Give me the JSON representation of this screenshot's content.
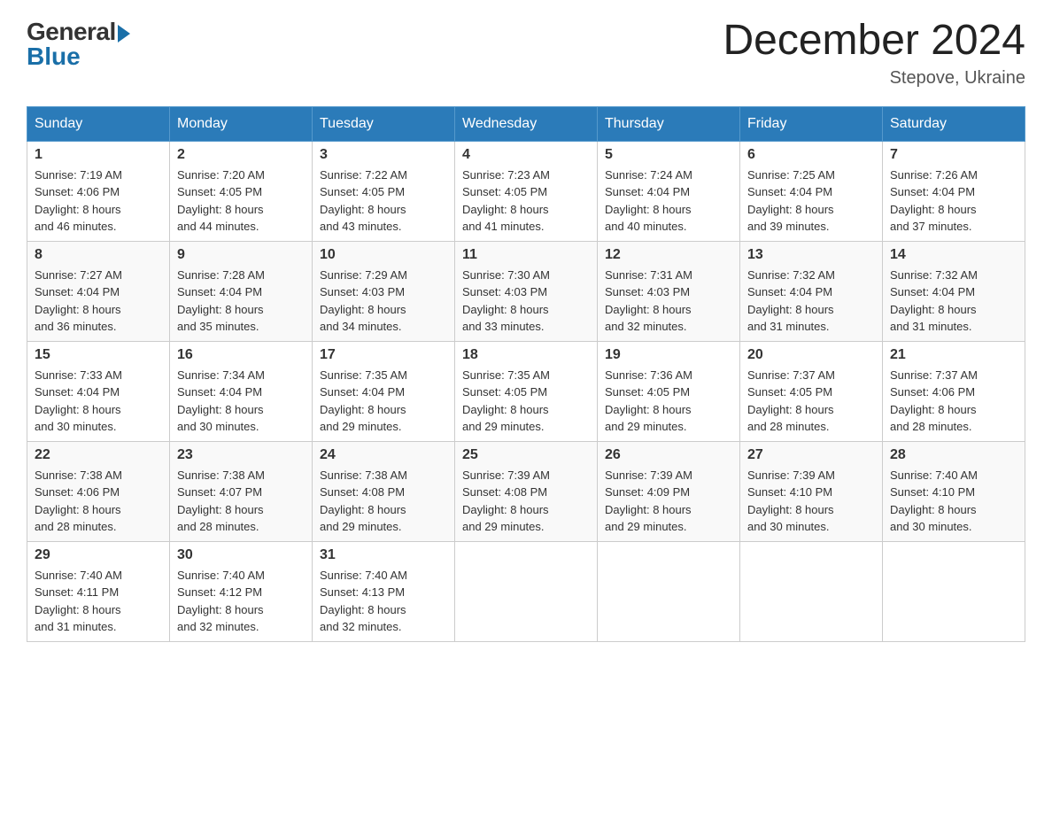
{
  "header": {
    "logo_general": "General",
    "logo_blue": "Blue",
    "month_title": "December 2024",
    "location": "Stepove, Ukraine"
  },
  "weekdays": [
    "Sunday",
    "Monday",
    "Tuesday",
    "Wednesday",
    "Thursday",
    "Friday",
    "Saturday"
  ],
  "weeks": [
    [
      {
        "day": "1",
        "sunrise": "7:19 AM",
        "sunset": "4:06 PM",
        "daylight": "8 hours and 46 minutes."
      },
      {
        "day": "2",
        "sunrise": "7:20 AM",
        "sunset": "4:05 PM",
        "daylight": "8 hours and 44 minutes."
      },
      {
        "day": "3",
        "sunrise": "7:22 AM",
        "sunset": "4:05 PM",
        "daylight": "8 hours and 43 minutes."
      },
      {
        "day": "4",
        "sunrise": "7:23 AM",
        "sunset": "4:05 PM",
        "daylight": "8 hours and 41 minutes."
      },
      {
        "day": "5",
        "sunrise": "7:24 AM",
        "sunset": "4:04 PM",
        "daylight": "8 hours and 40 minutes."
      },
      {
        "day": "6",
        "sunrise": "7:25 AM",
        "sunset": "4:04 PM",
        "daylight": "8 hours and 39 minutes."
      },
      {
        "day": "7",
        "sunrise": "7:26 AM",
        "sunset": "4:04 PM",
        "daylight": "8 hours and 37 minutes."
      }
    ],
    [
      {
        "day": "8",
        "sunrise": "7:27 AM",
        "sunset": "4:04 PM",
        "daylight": "8 hours and 36 minutes."
      },
      {
        "day": "9",
        "sunrise": "7:28 AM",
        "sunset": "4:04 PM",
        "daylight": "8 hours and 35 minutes."
      },
      {
        "day": "10",
        "sunrise": "7:29 AM",
        "sunset": "4:03 PM",
        "daylight": "8 hours and 34 minutes."
      },
      {
        "day": "11",
        "sunrise": "7:30 AM",
        "sunset": "4:03 PM",
        "daylight": "8 hours and 33 minutes."
      },
      {
        "day": "12",
        "sunrise": "7:31 AM",
        "sunset": "4:03 PM",
        "daylight": "8 hours and 32 minutes."
      },
      {
        "day": "13",
        "sunrise": "7:32 AM",
        "sunset": "4:04 PM",
        "daylight": "8 hours and 31 minutes."
      },
      {
        "day": "14",
        "sunrise": "7:32 AM",
        "sunset": "4:04 PM",
        "daylight": "8 hours and 31 minutes."
      }
    ],
    [
      {
        "day": "15",
        "sunrise": "7:33 AM",
        "sunset": "4:04 PM",
        "daylight": "8 hours and 30 minutes."
      },
      {
        "day": "16",
        "sunrise": "7:34 AM",
        "sunset": "4:04 PM",
        "daylight": "8 hours and 30 minutes."
      },
      {
        "day": "17",
        "sunrise": "7:35 AM",
        "sunset": "4:04 PM",
        "daylight": "8 hours and 29 minutes."
      },
      {
        "day": "18",
        "sunrise": "7:35 AM",
        "sunset": "4:05 PM",
        "daylight": "8 hours and 29 minutes."
      },
      {
        "day": "19",
        "sunrise": "7:36 AM",
        "sunset": "4:05 PM",
        "daylight": "8 hours and 29 minutes."
      },
      {
        "day": "20",
        "sunrise": "7:37 AM",
        "sunset": "4:05 PM",
        "daylight": "8 hours and 28 minutes."
      },
      {
        "day": "21",
        "sunrise": "7:37 AM",
        "sunset": "4:06 PM",
        "daylight": "8 hours and 28 minutes."
      }
    ],
    [
      {
        "day": "22",
        "sunrise": "7:38 AM",
        "sunset": "4:06 PM",
        "daylight": "8 hours and 28 minutes."
      },
      {
        "day": "23",
        "sunrise": "7:38 AM",
        "sunset": "4:07 PM",
        "daylight": "8 hours and 28 minutes."
      },
      {
        "day": "24",
        "sunrise": "7:38 AM",
        "sunset": "4:08 PM",
        "daylight": "8 hours and 29 minutes."
      },
      {
        "day": "25",
        "sunrise": "7:39 AM",
        "sunset": "4:08 PM",
        "daylight": "8 hours and 29 minutes."
      },
      {
        "day": "26",
        "sunrise": "7:39 AM",
        "sunset": "4:09 PM",
        "daylight": "8 hours and 29 minutes."
      },
      {
        "day": "27",
        "sunrise": "7:39 AM",
        "sunset": "4:10 PM",
        "daylight": "8 hours and 30 minutes."
      },
      {
        "day": "28",
        "sunrise": "7:40 AM",
        "sunset": "4:10 PM",
        "daylight": "8 hours and 30 minutes."
      }
    ],
    [
      {
        "day": "29",
        "sunrise": "7:40 AM",
        "sunset": "4:11 PM",
        "daylight": "8 hours and 31 minutes."
      },
      {
        "day": "30",
        "sunrise": "7:40 AM",
        "sunset": "4:12 PM",
        "daylight": "8 hours and 32 minutes."
      },
      {
        "day": "31",
        "sunrise": "7:40 AM",
        "sunset": "4:13 PM",
        "daylight": "8 hours and 32 minutes."
      },
      null,
      null,
      null,
      null
    ]
  ],
  "labels": {
    "sunrise": "Sunrise:",
    "sunset": "Sunset:",
    "daylight": "Daylight:"
  }
}
